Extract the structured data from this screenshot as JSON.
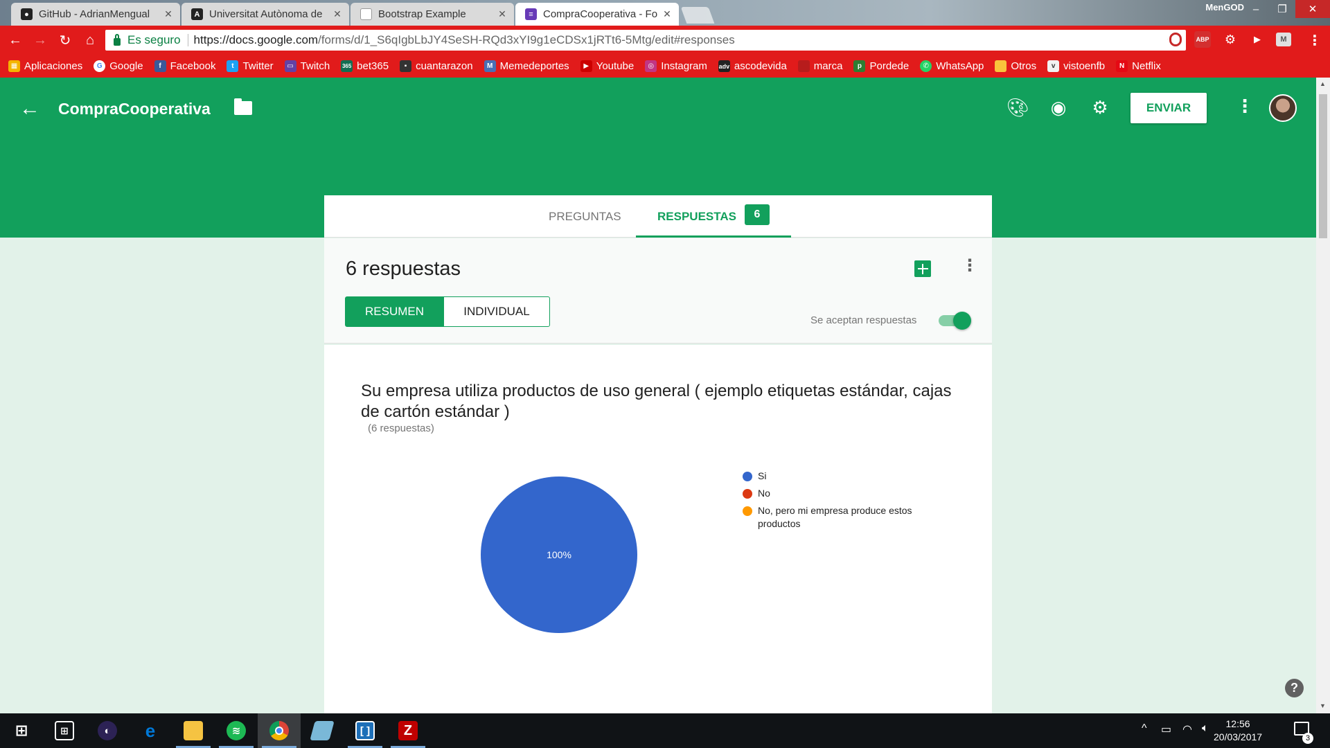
{
  "browser": {
    "tabs": [
      {
        "title": "GitHub - AdrianMengual",
        "favicon": "github-icon",
        "color": "#222222"
      },
      {
        "title": "Universitat Autònoma de",
        "favicon": "uab-icon",
        "color": "#222222"
      },
      {
        "title": "Bootstrap Example",
        "favicon": "page-icon",
        "color": "#9e9e9e"
      },
      {
        "title": "CompraCooperativa - Fo",
        "favicon": "forms-icon",
        "color": "#673ab7"
      }
    ],
    "window_user": "MenGOD",
    "address": {
      "secure_label": "Es seguro",
      "url_scheme_host": "https://docs.google.com",
      "url_path": "/forms/d/1_S6qIgbLbJY4SeSH-RQd3xYI9g1eCDSx1jRTt6-5Mtg/edit#responses"
    },
    "extensions": [
      {
        "name": "shield-extension-icon",
        "text": "",
        "color": "#c62828"
      },
      {
        "name": "adblock-plus-icon",
        "text": "ABP",
        "color": "#d32f2f"
      },
      {
        "name": "gear-extension-icon",
        "text": "⚙",
        "color": "#b71c1c"
      },
      {
        "name": "play-extension-icon",
        "text": "▶",
        "color": "#b71c1c"
      },
      {
        "name": "m-extension-icon",
        "text": "M",
        "color": "#bdbdbd"
      }
    ],
    "bookmarks": [
      {
        "label": "Aplicaciones",
        "icon": "apps-grid-icon",
        "color": "#f4b400"
      },
      {
        "label": "Google",
        "icon": "google-icon",
        "color": "#4285f4"
      },
      {
        "label": "Facebook",
        "icon": "facebook-icon",
        "color": "#3b5998"
      },
      {
        "label": "Twitter",
        "icon": "twitter-icon",
        "color": "#1da1f2"
      },
      {
        "label": "Twitch",
        "icon": "twitch-icon",
        "color": "#6441a5"
      },
      {
        "label": "bet365",
        "icon": "bet365-icon",
        "color": "#126e51"
      },
      {
        "label": "cuantarazon",
        "icon": "cuantarazon-icon",
        "color": "#333333"
      },
      {
        "label": "Memedeportes",
        "icon": "memedeportes-icon",
        "color": "#4a6fb5"
      },
      {
        "label": "Youtube",
        "icon": "youtube-icon",
        "color": "#cc0000"
      },
      {
        "label": "Instagram",
        "icon": "instagram-icon",
        "color": "#c13584"
      },
      {
        "label": "ascodevida",
        "icon": "ascodevida-icon",
        "color": "#222222"
      },
      {
        "label": "marca",
        "icon": "marca-icon",
        "color": "#b71c1c"
      },
      {
        "label": "Pordede",
        "icon": "pordede-icon",
        "color": "#2e7d32"
      },
      {
        "label": "WhatsApp",
        "icon": "whatsapp-icon",
        "color": "#25d366"
      },
      {
        "label": "Otros",
        "icon": "folder-icon",
        "color": "#f9c33c"
      },
      {
        "label": "vistoenfb",
        "icon": "vistoenfb-icon",
        "color": "#f2f2f2"
      },
      {
        "label": "Netflix",
        "icon": "netflix-icon",
        "color": "#e50914"
      }
    ]
  },
  "form": {
    "title": "CompraCooperativa",
    "send_label": "ENVIAR",
    "tabs": {
      "questions": "PREGUNTAS",
      "responses": "RESPUESTAS",
      "responses_count": "6"
    },
    "summary": {
      "response_count_text": "6 respuestas",
      "view_summary": "RESUMEN",
      "view_individual": "INDIVIDUAL",
      "accepting_label": "Se aceptan respuestas",
      "accepting": true
    },
    "question": {
      "title": "Su empresa utiliza productos de uso general ( ejemplo etiquetas estándar, cajas de cartón estándar )",
      "subtitle": "(6 respuestas)"
    }
  },
  "chart_data": {
    "type": "pie",
    "categories": [
      "Si",
      "No",
      "No, pero mi empresa produce estos productos"
    ],
    "values": [
      100,
      0,
      0
    ],
    "data_labels": [
      "100%"
    ],
    "colors": [
      "#3366cc",
      "#dc3912",
      "#ff9900"
    ],
    "legend_placement": "right"
  },
  "taskbar": {
    "apps": [
      {
        "name": "windows-start-icon",
        "color": "#101316"
      },
      {
        "name": "store-icon",
        "color": "#101316"
      },
      {
        "name": "eclipse-icon",
        "color": "#2c2255"
      },
      {
        "name": "edge-icon",
        "color": "#0078d7"
      },
      {
        "name": "file-explorer-icon",
        "color": "#f5c342"
      },
      {
        "name": "spotify-icon",
        "color": "#1db954"
      },
      {
        "name": "chrome-icon",
        "color": "#db4437"
      },
      {
        "name": "notepad-icon",
        "color": "#7ab8d8"
      },
      {
        "name": "brackets-icon",
        "color": "#1d6fb8"
      },
      {
        "name": "filezilla-icon",
        "color": "#bf0000"
      }
    ],
    "time": "12:56",
    "date": "20/03/2017",
    "notification_count": "3"
  }
}
